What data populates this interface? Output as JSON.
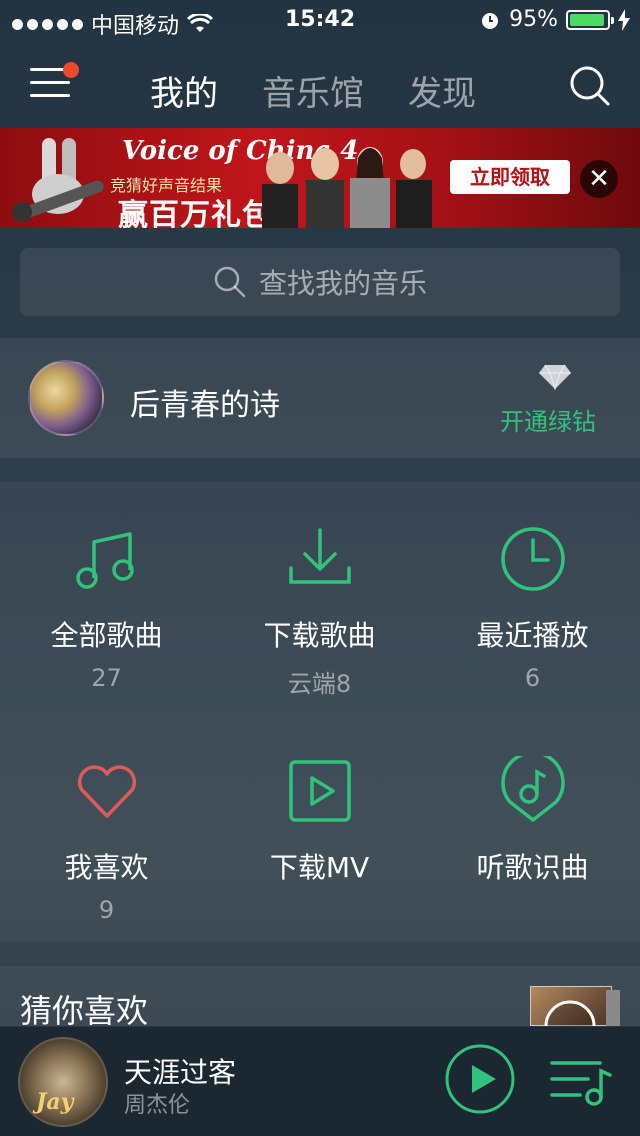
{
  "status_bar": {
    "carrier": "中国移动",
    "time": "15:42",
    "battery": "95%",
    "battery_level": 0.95,
    "icons": [
      "signal-dots",
      "wifi-icon",
      "alarm-icon",
      "battery-icon",
      "charging-icon"
    ]
  },
  "nav": {
    "tabs": [
      {
        "label": "我的",
        "active": true
      },
      {
        "label": "音乐馆",
        "active": false
      },
      {
        "label": "发现",
        "active": false
      }
    ],
    "icons": [
      "menu-icon",
      "search-icon"
    ],
    "notification_dot_color": "#f0482d"
  },
  "banner": {
    "logo": "Voice of China 4",
    "subtitle": "竞猜好声音结果",
    "headline": "赢百万礼包",
    "cta": "立即领取",
    "close": "✕",
    "colors": {
      "background": "#b51419",
      "cta_text": "#b01217"
    }
  },
  "search": {
    "placeholder": "查找我的音乐"
  },
  "profile": {
    "username": "后青春的诗",
    "vip_link": "开通绿钻",
    "accent": "#31c27c"
  },
  "grid": [
    {
      "icon": "music-note-icon",
      "label": "全部歌曲",
      "count": "27"
    },
    {
      "icon": "download-icon",
      "label": "下载歌曲",
      "count": "云端8"
    },
    {
      "icon": "clock-icon",
      "label": "最近播放",
      "count": "6"
    },
    {
      "icon": "heart-icon",
      "label": "我喜欢",
      "count": "9"
    },
    {
      "icon": "mv-play-icon",
      "label": "下载MV",
      "count": ""
    },
    {
      "icon": "song-recognition-icon",
      "label": "听歌识曲",
      "count": ""
    }
  ],
  "guess": {
    "title": "猜你喜欢"
  },
  "player": {
    "album_text": "Jay",
    "title": "天涯过客",
    "artist": "周杰伦",
    "icons": [
      "play-icon",
      "playlist-icon"
    ]
  }
}
